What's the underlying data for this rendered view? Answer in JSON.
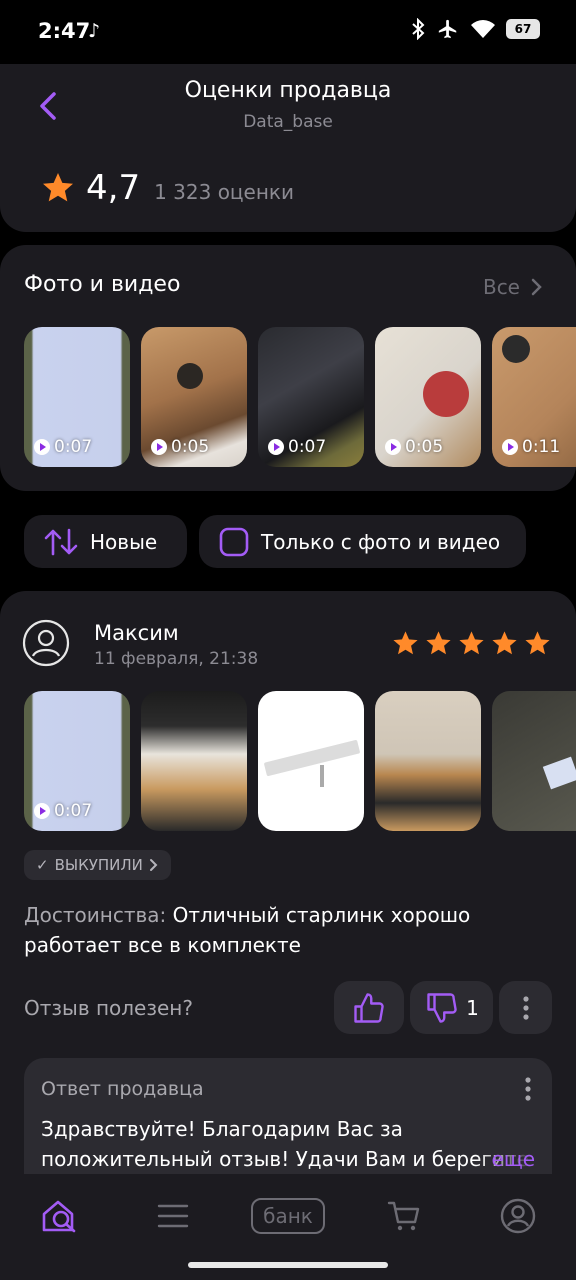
{
  "status": {
    "time": "2:47",
    "battery": "67"
  },
  "header": {
    "title": "Оценки продавца",
    "subtitle": "Data_base",
    "rating": "4,7",
    "rating_count": "1 323 оценки"
  },
  "media": {
    "title": "Фото и видео",
    "all_label": "Все",
    "items": [
      {
        "duration": "0:07"
      },
      {
        "duration": "0:05"
      },
      {
        "duration": "0:07"
      },
      {
        "duration": "0:05"
      },
      {
        "duration": "0:11"
      }
    ]
  },
  "filters": {
    "sort_label": "Новые",
    "media_only_label": "Только с фото и видео"
  },
  "review": {
    "author": "Максим",
    "date": "11 февраля, 21:38",
    "stars": 5,
    "first_thumb_duration": "0:07",
    "badge": "ВЫКУПИЛИ",
    "pros_label": "Достоинства:",
    "pros_text": "Отличный старлинк хорошо работает все в комплекте",
    "useful_question": "Отзыв полезен?",
    "dislike_count": "1",
    "reply_title": "Ответ продавца",
    "reply_text": "Здравствуйте! Благодарим Вас за положительный отзыв! Удачи Вам и берегите",
    "reply_more": "еще"
  },
  "nav": {
    "bank_label": "банк",
    "accent": "#a35cf5"
  }
}
